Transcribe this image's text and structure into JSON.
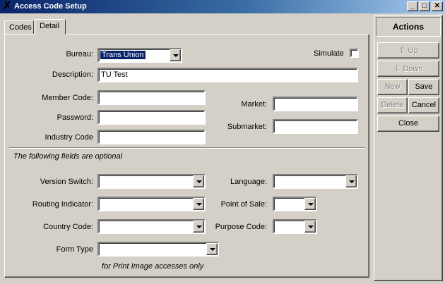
{
  "window": {
    "title": "Access Code Setup",
    "app_icon": "app-x-icon",
    "minimize_glyph": "_",
    "maximize_glyph": "□",
    "close_glyph": "✕"
  },
  "tabs": [
    {
      "label": "Codes",
      "active": false
    },
    {
      "label": "Detail",
      "active": true
    }
  ],
  "form": {
    "bureau_label": "Bureau:",
    "bureau_value": "Trans Union",
    "simulate_label": "Simulate",
    "simulate_checked": false,
    "description_label": "Description:",
    "description_value": "TU Test",
    "member_code_label": "Member Code:",
    "member_code_value": "",
    "password_label": "Password:",
    "password_value": "",
    "industry_code_label": "Industry Code",
    "industry_code_value": "",
    "market_label": "Market:",
    "market_value": "",
    "submarket_label": "Submarket:",
    "submarket_value": "",
    "optional_note": "The following fields are optional",
    "version_switch_label": "Version Switch:",
    "version_switch_value": "",
    "routing_indicator_label": "Routing Indicator:",
    "routing_indicator_value": "",
    "country_code_label": "Country Code:",
    "country_code_value": "",
    "form_type_label": "Form Type",
    "form_type_value": "",
    "language_label": "Language:",
    "language_value": "",
    "point_of_sale_label": "Point of Sale:",
    "point_of_sale_value": "",
    "purpose_code_label": "Purpose Code:",
    "purpose_code_value": "",
    "print_image_note": "for Print Image accesses only"
  },
  "actions": {
    "header": "Actions",
    "up_label": "Up",
    "down_label": "Down",
    "new_label": "New",
    "save_label": "Save",
    "delete_label": "Delete",
    "cancel_label": "Cancel",
    "close_label": "Close",
    "disabled_color": "#808080"
  }
}
